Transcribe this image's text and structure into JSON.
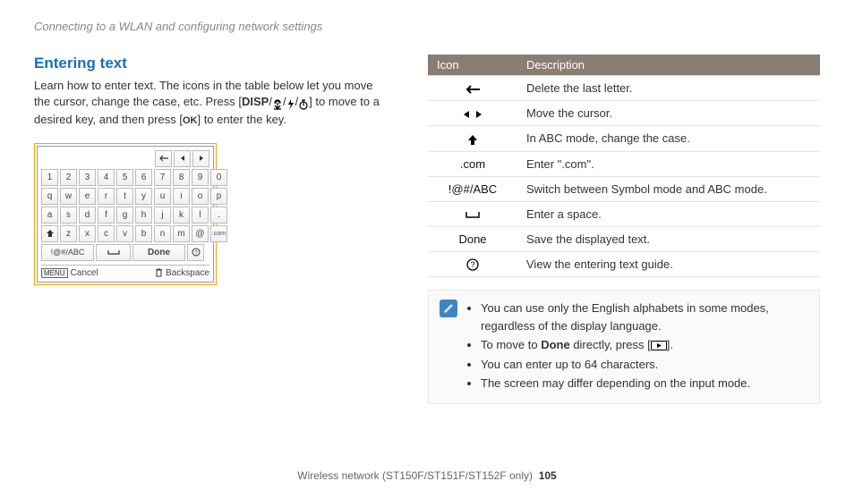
{
  "breadcrumb": "Connecting to a WLAN and configuring network settings",
  "section_title": "Entering text",
  "intro_before": "Learn how to enter text. The icons in the table below let you move the cursor, change the case, etc. Press [",
  "intro_disp": "DISP",
  "intro_mid": "] to move to a desired key, and then press [",
  "intro_ok": "OK",
  "intro_after": "] to enter the key.",
  "keyboard": {
    "row1": [
      "1",
      "2",
      "3",
      "4",
      "5",
      "6",
      "7",
      "8",
      "9",
      "0"
    ],
    "row2": [
      "q",
      "w",
      "e",
      "r",
      "t",
      "y",
      "u",
      "i",
      "o",
      "p"
    ],
    "row3": [
      "a",
      "s",
      "d",
      "f",
      "g",
      "h",
      "j",
      "k",
      "l",
      "."
    ],
    "row4_keys": [
      "z",
      "x",
      "c",
      "v",
      "b",
      "n",
      "m",
      "@"
    ],
    "row4_com": ".com",
    "mode_label": "!@#/ABC",
    "done_label": "Done",
    "cancel_badge": "MENU",
    "cancel_label": "Cancel",
    "backspace_label": "Backspace"
  },
  "table": {
    "header_icon": "Icon",
    "header_desc": "Description",
    "rows": [
      {
        "icon_type": "arrow_left",
        "desc": "Delete the last letter."
      },
      {
        "icon_type": "arrow_lr",
        "desc": "Move the cursor."
      },
      {
        "icon_type": "arrow_up",
        "desc": "In ABC mode, change the case."
      },
      {
        "icon_type": "text",
        "icon_text": ".com",
        "desc": "Enter \".com\"."
      },
      {
        "icon_type": "text",
        "icon_text": "!@#/ABC",
        "desc": "Switch between Symbol mode and ABC mode."
      },
      {
        "icon_type": "space",
        "desc": "Enter a space."
      },
      {
        "icon_type": "text",
        "icon_text": "Done",
        "desc": "Save the displayed text."
      },
      {
        "icon_type": "help",
        "desc": "View the entering text guide."
      }
    ]
  },
  "notes": {
    "items": [
      {
        "prefix": "You can use only the English alphabets in some modes, regardless of the display language."
      },
      {
        "prefix": "To move to ",
        "bold": "Done",
        "mid": " directly, press [",
        "icon": "play",
        "after": "]."
      },
      {
        "prefix": "You can enter up to 64 characters."
      },
      {
        "prefix": "The screen may differ depending on the input mode."
      }
    ]
  },
  "footer_text": "Wireless network  (ST150F/ST151F/ST152F only)",
  "footer_page": "105"
}
